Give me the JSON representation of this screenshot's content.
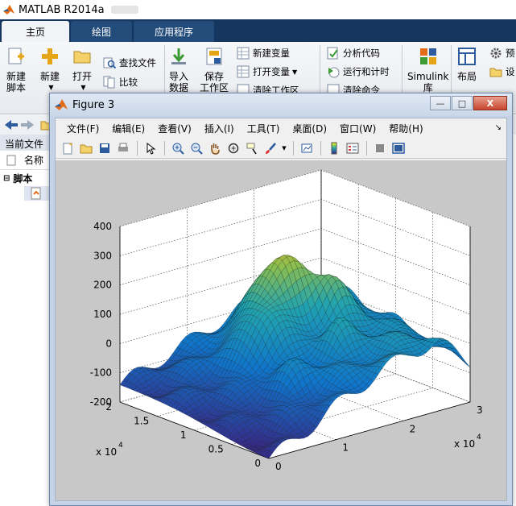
{
  "app": {
    "title": "MATLAB R2014a"
  },
  "tabs": [
    {
      "label": "主页"
    },
    {
      "label": "绘图"
    },
    {
      "label": "应用程序"
    }
  ],
  "ribbon": {
    "new_script": [
      "新建",
      "脚本"
    ],
    "new": "新建",
    "open": "打开",
    "find_files": "查找文件",
    "compare": "比较",
    "import": [
      "导入",
      "数据"
    ],
    "save": [
      "保存",
      "工作区"
    ],
    "new_variable": "新建变量",
    "open_variable": "打开变量",
    "clear_workspace": "清除工作区",
    "analyze_code": "分析代码",
    "run_and_time": "运行和计时",
    "clear_commands": "清除命令",
    "simulink": [
      "Simulink",
      "库"
    ],
    "layout": "布局",
    "preferences": "预",
    "set": "设"
  },
  "current_folder": {
    "label": "当前文件夹",
    "name_header": "名称",
    "group": "脚本"
  },
  "figure": {
    "title": "Figure 3",
    "menu": [
      "文件(F)",
      "编辑(E)",
      "查看(V)",
      "插入(I)",
      "工具(T)",
      "桌面(D)",
      "窗口(W)",
      "帮助(H)"
    ],
    "window_buttons": {
      "minimize": "—",
      "restore": "□",
      "close": "X"
    }
  },
  "chart_data": {
    "type": "surface",
    "title": "",
    "x_label": "",
    "y_label": "",
    "z_label": "",
    "x_ticks": [
      "0",
      "1",
      "2",
      "3"
    ],
    "x_exponent": "x 10",
    "x_exponent_power": "4",
    "y_ticks": [
      "0",
      "0.5",
      "1",
      "1.5",
      "2"
    ],
    "y_exponent": "x 10",
    "y_exponent_power": "4",
    "z_ticks": [
      "-200",
      "-100",
      "0",
      "100",
      "200",
      "300",
      "400"
    ],
    "x_range": [
      0,
      30000
    ],
    "y_range": [
      0,
      20000
    ],
    "z_range": [
      -200,
      400
    ],
    "grid": true,
    "colormap": "parula",
    "surface_peak_z": 400
  },
  "colors": {
    "tabbar": "#15375f",
    "surface_low": "#352a87",
    "surface_mid": "#21a3af",
    "surface_high": "#f9fb0e"
  }
}
